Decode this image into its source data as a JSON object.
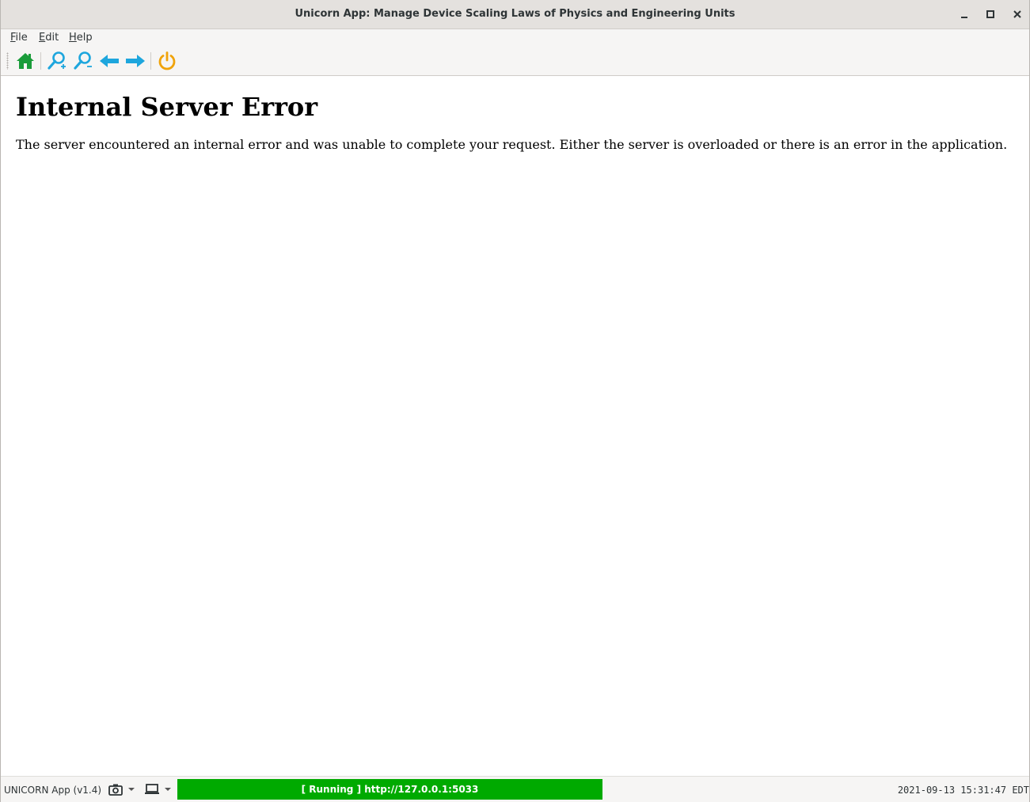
{
  "window": {
    "title": "Unicorn App: Manage Device Scaling Laws of Physics and Engineering Units"
  },
  "menubar": {
    "items": [
      {
        "label": "File"
      },
      {
        "label": "Edit"
      },
      {
        "label": "Help"
      }
    ]
  },
  "toolbar": {
    "buttons": [
      {
        "icon": "home-icon",
        "color": "#1a9c3a"
      },
      {
        "icon": "zoom-in-icon",
        "color": "#1ea6dd"
      },
      {
        "icon": "zoom-out-icon",
        "color": "#1ea6dd"
      },
      {
        "icon": "arrow-left-icon",
        "color": "#1ea6dd"
      },
      {
        "icon": "arrow-right-icon",
        "color": "#1ea6dd"
      },
      {
        "icon": "power-icon",
        "color": "#f0a30a"
      }
    ]
  },
  "content": {
    "heading": "Internal Server Error",
    "message": "The server encountered an internal error and was unable to complete your request. Either the server is overloaded or there is an error in the application."
  },
  "statusbar": {
    "app_version": "UNICORN App (v1.4)",
    "status_text": "[ Running ] http://127.0.0.1:5033",
    "status_color": "#00aa00",
    "clock": "2021-09-13 15:31:47 EDT"
  }
}
